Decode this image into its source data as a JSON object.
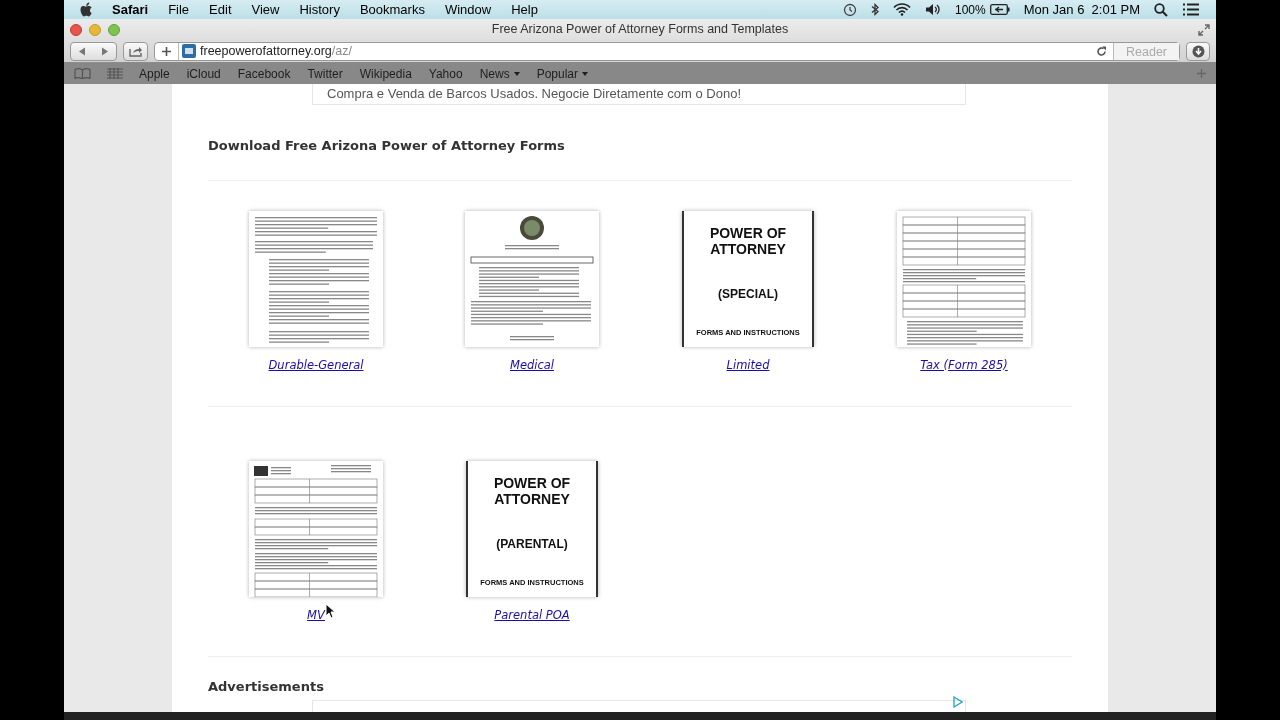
{
  "menu_bar": {
    "app": "Safari",
    "items": [
      "File",
      "Edit",
      "View",
      "History",
      "Bookmarks",
      "Window",
      "Help"
    ],
    "battery": "100%",
    "clock": "Mon Jan 6  2:01 PM"
  },
  "window": {
    "title": "Free Arizona Power of Attorney Forms and Templates"
  },
  "toolbar": {
    "url_host": "freepowerofattorney.org",
    "url_path": "/az/",
    "reader": "Reader"
  },
  "bookmarks": [
    {
      "label": "Apple",
      "menu": false
    },
    {
      "label": "iCloud",
      "menu": false
    },
    {
      "label": "Facebook",
      "menu": false
    },
    {
      "label": "Twitter",
      "menu": false
    },
    {
      "label": "Wikipedia",
      "menu": false
    },
    {
      "label": "Yahoo",
      "menu": false
    },
    {
      "label": "News",
      "menu": true
    },
    {
      "label": "Popular",
      "menu": true
    }
  ],
  "ad_line": "Compra e Venda de Barcos Usados. Negocie Diretamente com o Dono!",
  "section_title": "Download Free Arizona Power of Attorney Forms",
  "form_rows": [
    [
      {
        "kind": "text-doc",
        "link": "Durable-General"
      },
      {
        "kind": "seal-doc",
        "link": "Medical"
      },
      {
        "kind": "cover",
        "cover_lines": [
          "POWER OF",
          "ATTORNEY",
          "(SPECIAL)",
          "FORMS AND INSTRUCTIONS"
        ],
        "link": "Limited"
      },
      {
        "kind": "form-doc",
        "link": "Tax (Form 285)"
      }
    ],
    [
      {
        "kind": "mvd-doc",
        "link": "MV"
      },
      {
        "kind": "cover",
        "cover_lines": [
          "POWER OF",
          "ATTORNEY",
          "(PARENTAL)",
          "FORMS AND INSTRUCTIONS"
        ],
        "link": "Parental POA"
      }
    ]
  ],
  "ads_title": "Advertisements"
}
